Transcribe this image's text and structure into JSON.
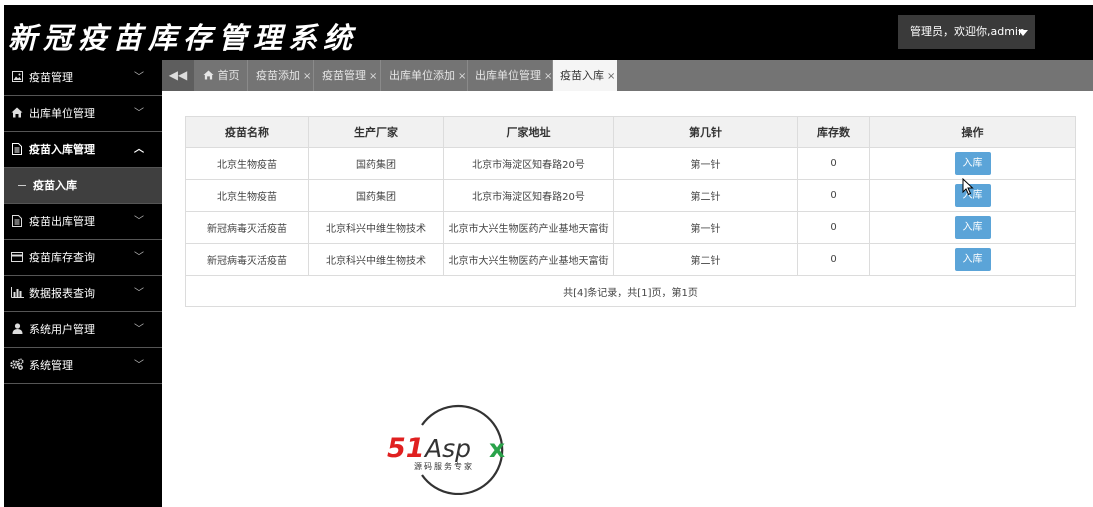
{
  "header": {
    "title": "新冠疫苗库存管理系统",
    "user_label": "管理员，欢迎你,admin"
  },
  "sidebar": {
    "items": [
      {
        "label": "疫苗管理",
        "icon": "image-icon"
      },
      {
        "label": "出库单位管理",
        "icon": "home-icon"
      },
      {
        "label": "疫苗入库管理",
        "icon": "document-icon",
        "expanded": true
      },
      {
        "label": "疫苗出库管理",
        "icon": "document-icon"
      },
      {
        "label": "疫苗库存查询",
        "icon": "card-icon"
      },
      {
        "label": "数据报表查询",
        "icon": "bar-chart-icon"
      },
      {
        "label": "系统用户管理",
        "icon": "user-icon"
      },
      {
        "label": "系统管理",
        "icon": "gears-icon"
      }
    ],
    "sub_item": "疫苗入库"
  },
  "tabs": [
    {
      "label": "首页"
    },
    {
      "label": "疫苗添加"
    },
    {
      "label": "疫苗管理"
    },
    {
      "label": "出库单位添加"
    },
    {
      "label": "出库单位管理"
    },
    {
      "label": "疫苗入库",
      "active": true
    }
  ],
  "table": {
    "columns": [
      "疫苗名称",
      "生产厂家",
      "厂家地址",
      "第几针",
      "库存数",
      "操作"
    ],
    "rows": [
      {
        "name": "北京生物疫苗",
        "maker": "国药集团",
        "address": "北京市海淀区知春路20号",
        "dose": "第一针",
        "stock": "0",
        "action": "入库"
      },
      {
        "name": "北京生物疫苗",
        "maker": "国药集团",
        "address": "北京市海淀区知春路20号",
        "dose": "第二针",
        "stock": "0",
        "action": "入库"
      },
      {
        "name": "新冠病毒灭活疫苗",
        "maker": "北京科兴中维生物技术",
        "address": "北京市大兴生物医药产业基地天富街",
        "dose": "第一针",
        "stock": "0",
        "action": "入库"
      },
      {
        "name": "新冠病毒灭活疫苗",
        "maker": "北京科兴中维生物技术",
        "address": "北京市大兴生物医药产业基地天富街",
        "dose": "第二针",
        "stock": "0",
        "action": "入库"
      }
    ],
    "pager": "共[4]条记录，共[1]页，第1页"
  },
  "watermark": {
    "brand": "51Aspx",
    "tagline": "源码服务专家"
  },
  "colors": {
    "header_bg": "#000000",
    "tabbar_bg": "#747474",
    "button": "#5ba4d8",
    "logo_red": "#e02020",
    "logo_green": "#2aa34a"
  }
}
